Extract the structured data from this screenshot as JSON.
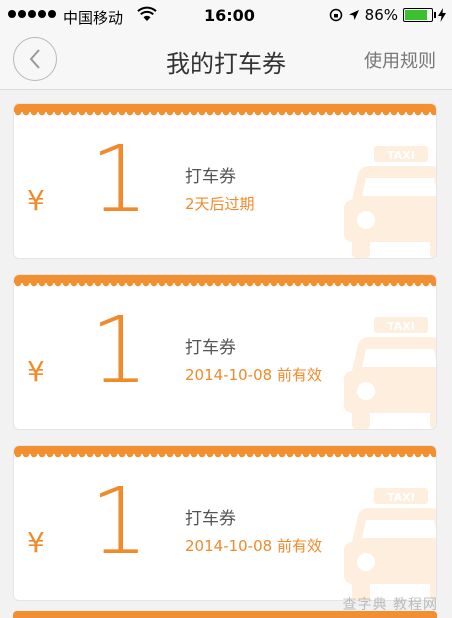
{
  "status_bar": {
    "carrier": "中国移动",
    "time": "16:00",
    "battery": "86%"
  },
  "nav": {
    "title": "我的打车券",
    "rules_label": "使用规则"
  },
  "coupons": [
    {
      "currency": "¥",
      "amount": "1",
      "name": "打车券",
      "expiry": "2天后过期",
      "badge": "TAXI"
    },
    {
      "currency": "¥",
      "amount": "1",
      "name": "打车券",
      "expiry": "2014-10-08 前有效",
      "badge": "TAXI"
    },
    {
      "currency": "¥",
      "amount": "1",
      "name": "打车券",
      "expiry": "2014-10-08 前有效",
      "badge": "TAXI"
    }
  ],
  "watermark": "查字典 教程网"
}
